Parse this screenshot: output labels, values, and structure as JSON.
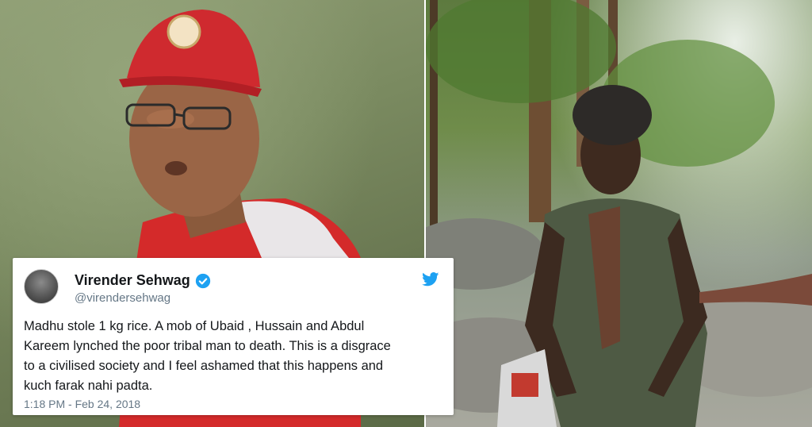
{
  "tweet": {
    "display_name": "Virender Sehwag",
    "handle": "@virendersehwag",
    "text": "Madhu stole 1 kg rice. A mob of Ubaid , Hussain and Abdul\nKareem lynched the poor tribal man to death. This is a disgrace\nto a civilised society and I feel ashamed that this happens and\nkuch farak nahi padta.",
    "timestamp": "1:18 PM - Feb 24, 2018",
    "verified_icon": "verified-badge-icon",
    "platform_icon": "twitter-bird-icon"
  },
  "colors": {
    "twitter_blue": "#1da1f2",
    "text": "#14171a",
    "muted": "#657786"
  }
}
